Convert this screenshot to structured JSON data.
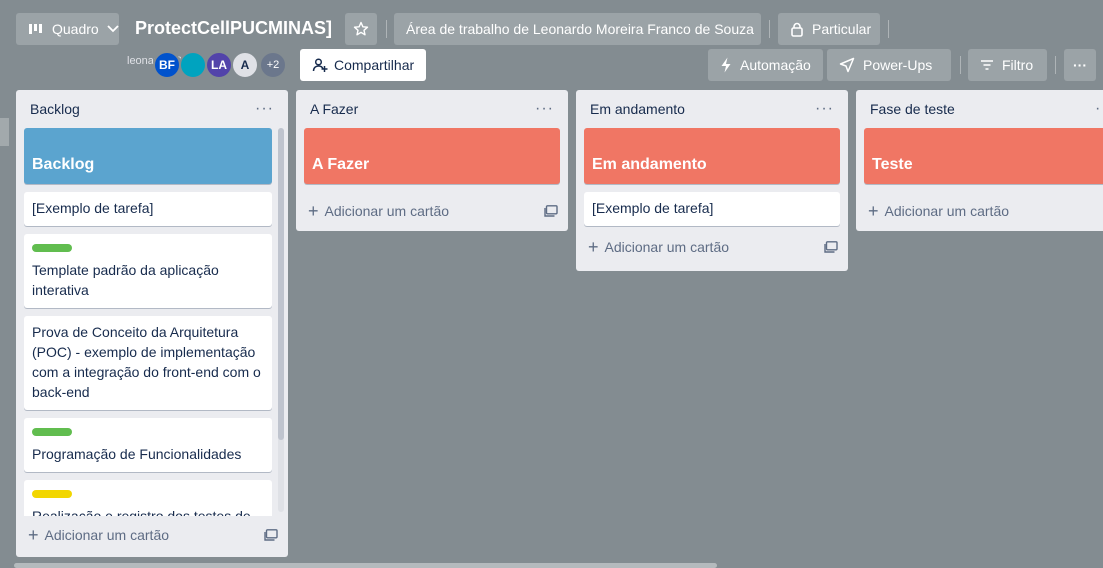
{
  "header": {
    "view_switch_label": "Quadro",
    "board_title": "ProtectCellPUCMINAS]",
    "workspace_label": "Área de trabalho de Leonardo Moreira Franco de Souza",
    "visibility_label": "Particular",
    "share_label": "Compartilhar",
    "automation_label": "Automação",
    "powerups_label": "Power-Ups",
    "filter_label": "Filtro",
    "more_label": "···"
  },
  "members": {
    "broken_avatar_text": "leonardoh231",
    "avatars": [
      {
        "initials": "BF",
        "color": "#0052cc"
      },
      {
        "initials": "",
        "color": "#00a3bf"
      },
      {
        "initials": "LA",
        "color": "#5243aa"
      },
      {
        "initials": "A",
        "color": "#dfe1e6"
      }
    ],
    "extra_count": "+2"
  },
  "lists": [
    {
      "title": "Backlog",
      "menu": "···",
      "cover": {
        "text": "Backlog",
        "color": "#5ba4cf"
      },
      "cards": [
        {
          "text": "[Exemplo de tarefa]",
          "label_color": ""
        },
        {
          "text": "Template padrão da aplicação interativa",
          "label_color": "#61bd4f"
        },
        {
          "text": "Prova de Conceito da Arquitetura (POC) - exemplo de implementação com a integração do front-end com o back-end",
          "label_color": ""
        },
        {
          "text": "Programação de Funcionalidades",
          "label_color": "#61bd4f"
        },
        {
          "text": "Realização e registro dos testes de",
          "label_color": "#f2d600"
        }
      ],
      "add_label": "Adicionar um cartão"
    },
    {
      "title": "A Fazer",
      "menu": "···",
      "cover": {
        "text": "A Fazer",
        "color": "#f07664"
      },
      "cards": [],
      "add_label": "Adicionar um cartão"
    },
    {
      "title": "Em andamento",
      "menu": "···",
      "cover": {
        "text": "Em andamento",
        "color": "#f07664"
      },
      "cards": [
        {
          "text": "[Exemplo de tarefa]",
          "label_color": ""
        }
      ],
      "add_label": "Adicionar um cartão"
    },
    {
      "title": "Fase de teste",
      "menu": "···",
      "cover": {
        "text": "Teste",
        "color": "#f07664"
      },
      "cards": [],
      "add_label": "Adicionar um cartão"
    }
  ],
  "icons": [
    "board-icon",
    "chevron-down-icon",
    "star-icon",
    "lock-icon",
    "add-person-icon",
    "lightning-icon",
    "rocket-icon",
    "filter-icon",
    "template-icon",
    "plus-icon"
  ]
}
